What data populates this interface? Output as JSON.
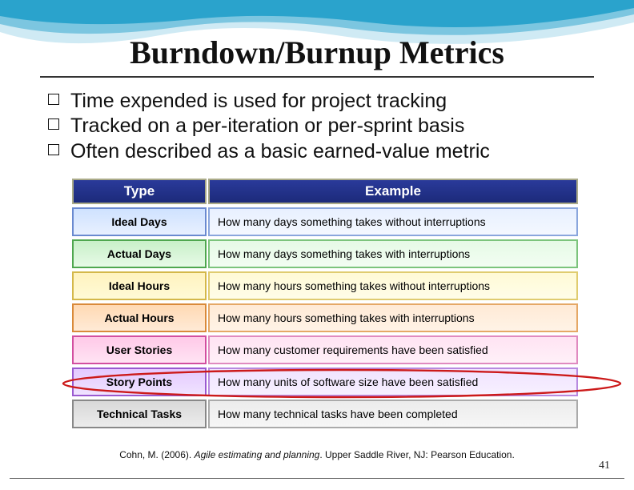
{
  "title": "Burndown/Burnup Metrics",
  "bullets": [
    "Time expended is used for project tracking",
    "Tracked on a per-iteration or per-sprint basis",
    "Often described as a basic earned-value metric"
  ],
  "table": {
    "head_type": "Type",
    "head_example": "Example",
    "rows": [
      {
        "type": "Ideal Days",
        "example": "How many days something takes without interruptions"
      },
      {
        "type": "Actual Days",
        "example": "How many days something takes with interruptions"
      },
      {
        "type": "Ideal Hours",
        "example": "How many hours something takes without interruptions"
      },
      {
        "type": "Actual Hours",
        "example": "How many hours something takes with interruptions"
      },
      {
        "type": "User Stories",
        "example": "How many customer requirements have been satisfied"
      },
      {
        "type": "Story Points",
        "example": "How many units of software size have been satisfied"
      },
      {
        "type": "Technical Tasks",
        "example": "How many technical tasks have been completed"
      }
    ]
  },
  "citation": {
    "author": "Cohn, M. (2006). ",
    "work": "Agile estimating and planning",
    "rest": ". Upper Saddle River, NJ: Pearson Education."
  },
  "page_number": "41"
}
